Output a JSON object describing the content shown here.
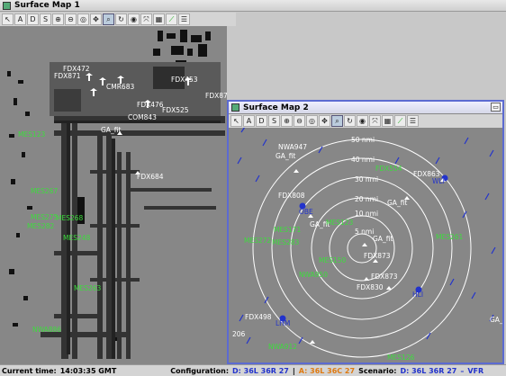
{
  "window1": {
    "title": "Surface Map 1"
  },
  "window2": {
    "title": "Surface Map 2",
    "restore_glyph": "▭"
  },
  "toolbar": {
    "buttons": [
      {
        "icon": "cursor-icon",
        "glyph": "↖"
      },
      {
        "icon": "a-icon",
        "glyph": "A"
      },
      {
        "icon": "d-icon",
        "glyph": "D"
      },
      {
        "icon": "s-icon",
        "glyph": "S"
      },
      {
        "icon": "zoom-in-icon",
        "glyph": "⊕"
      },
      {
        "icon": "zoom-out-icon",
        "glyph": "⊖"
      },
      {
        "icon": "zoom-reset-icon",
        "glyph": "◎"
      },
      {
        "icon": "pan-icon",
        "glyph": "✥"
      },
      {
        "icon": "search-icon",
        "glyph": "⌕"
      },
      {
        "icon": "rotate-icon",
        "glyph": "↻"
      },
      {
        "icon": "target-icon",
        "glyph": "◉"
      },
      {
        "icon": "fit-icon",
        "glyph": "⤧"
      },
      {
        "icon": "grid-icon",
        "glyph": "▦"
      },
      {
        "icon": "signal-icon",
        "glyph": "⟋"
      },
      {
        "icon": "list-icon",
        "glyph": "☰"
      }
    ]
  },
  "map1": {
    "labels_white": [
      "FDX871",
      "FDX472",
      "FDX453",
      "FDX87M",
      "CMR683",
      "COM843",
      "FDX476",
      "FDX525",
      "GA_fit",
      "FDX684"
    ],
    "labels_green": [
      "MES123",
      "MES267",
      "MES275",
      "MES282",
      "MES268",
      "MES248",
      "MES263",
      "NWA886"
    ]
  },
  "map2": {
    "range_rings": [
      "5 nmi",
      "10 nmi",
      "20 nmi",
      "30 nmi",
      "40 nmi",
      "50 nmi"
    ],
    "labels_white": [
      "NWA947",
      "GA_fit",
      "FDX863",
      "GA_fit",
      "FDX808",
      "GA_fit",
      "GA_fit",
      "FDX873",
      "FDX873",
      "FDX830",
      "FDX498",
      "GA_",
      "206"
    ],
    "labels_green": [
      "FDX554",
      "MES123",
      "MES171",
      "MES272",
      "MES283",
      "MES261",
      "MES150",
      "NWA950",
      "NWA912",
      "MES126"
    ],
    "labels_blue": [
      "WLF",
      "OBE",
      "HLI",
      "LHM"
    ]
  },
  "status": {
    "current_time_label": "Current time:",
    "current_time": "14:03:35 GMT",
    "config_label": "Configuration:",
    "config_d": "D: 36L 36R 27",
    "sep": "|",
    "config_a": "A: 36L 36C 27",
    "scenario_label": "Scenario:",
    "scenario_d": "D: 36L 36R 27",
    "scenario_dash": "–",
    "scenario_rules": "VFR"
  },
  "colors": {
    "accent_blue": "#2233cc",
    "arrival_orange": "#e07a10",
    "green_label": "#3ddc3d",
    "window_border": "#5c6bd1"
  }
}
